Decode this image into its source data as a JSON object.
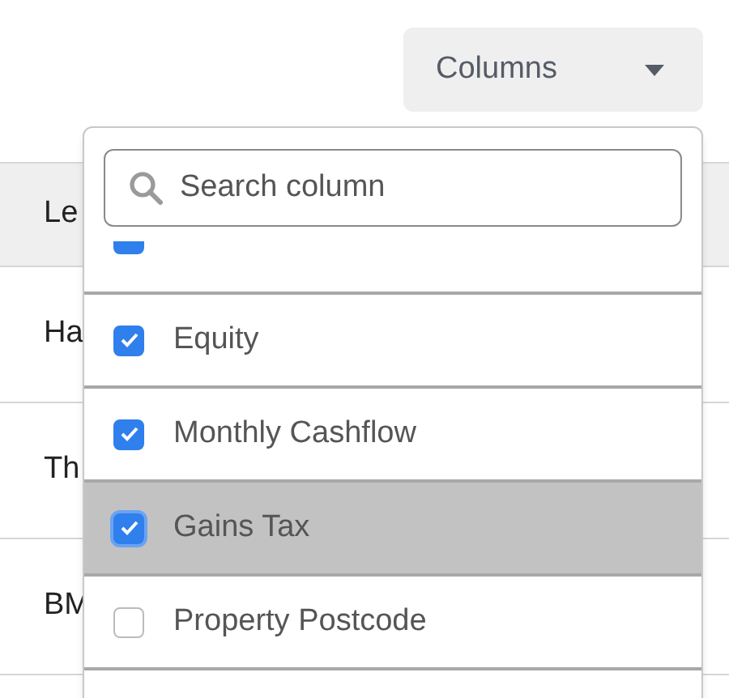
{
  "table": {
    "header": [
      "Le"
    ],
    "rows": [
      [
        "Ha"
      ],
      [
        "Th"
      ],
      [
        "BM"
      ]
    ]
  },
  "columns_button": {
    "label": "Columns"
  },
  "columns_menu": {
    "search": {
      "placeholder": "Search column"
    },
    "items": [
      {
        "kind": "partial",
        "checked": true,
        "highlighted": false
      },
      {
        "label": "Equity",
        "checked": true,
        "highlighted": false
      },
      {
        "label": "Monthly Cashflow",
        "checked": true,
        "highlighted": false
      },
      {
        "label": "Gains Tax",
        "checked": true,
        "highlighted": true
      },
      {
        "label": "Property Postcode",
        "checked": false,
        "highlighted": false
      }
    ]
  }
}
